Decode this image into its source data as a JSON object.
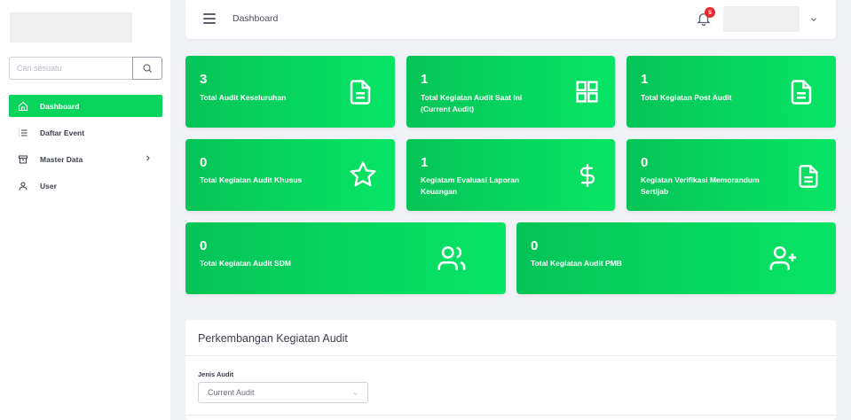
{
  "sidebar": {
    "search_placeholder": "Cari sesuatu",
    "items": [
      {
        "label": "Dashboard",
        "icon": "home-icon",
        "active": true
      },
      {
        "label": "Daftar Event",
        "icon": "list-icon"
      },
      {
        "label": "Master Data",
        "icon": "archive-icon",
        "has_submenu": true
      },
      {
        "label": "User",
        "icon": "user-icon"
      }
    ]
  },
  "header": {
    "title": "Dashboard",
    "notification_count": "5"
  },
  "cards": [
    {
      "value": "3",
      "label": "Total Audit Keseluruhan",
      "icon": "document-icon"
    },
    {
      "value": "1",
      "label": "Total Kegiatan Audit Saat Ini (Current Audit)",
      "icon": "grid-icon"
    },
    {
      "value": "1",
      "label": "Total Kegiatan Post Audit",
      "icon": "document-icon"
    },
    {
      "value": "0",
      "label": "Total Kegiatan Audit Khusus",
      "icon": "star-icon"
    },
    {
      "value": "1",
      "label": "Kegiatam Evaluasi Laporan Keuangan",
      "icon": "dollar-icon"
    },
    {
      "value": "0",
      "label": "Kegiatan Verifikasi Memorandum Sertijab",
      "icon": "document-icon"
    },
    {
      "value": "0",
      "label": "Total Kegiatan Audit SDM",
      "icon": "users-icon"
    },
    {
      "value": "0",
      "label": "Total Kegiatan Audit PMB",
      "icon": "user-plus-icon"
    }
  ],
  "panel": {
    "title": "Perkembangan Kegiatan Audit",
    "field_label": "Jenis Audit",
    "select_value": "Current Audit"
  },
  "colors": {
    "accent": "#0bd45c",
    "card_gradient_start": "#06c457",
    "card_gradient_end": "#07e565",
    "badge": "#ea2a2a"
  }
}
